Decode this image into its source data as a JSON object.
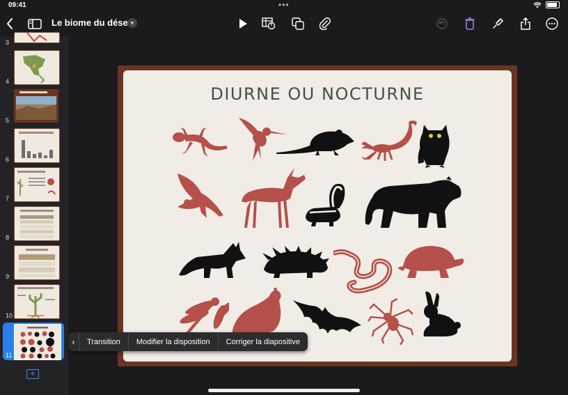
{
  "status_bar": {
    "time": "09:41"
  },
  "toolbar": {
    "document_title": "Le biome du désert",
    "icons": [
      "back-chevron-icon",
      "sidebar-toggle-icon",
      "play-icon",
      "table-chart-icon",
      "shapes-icon",
      "attachment-icon",
      "undo-icon",
      "trash-icon",
      "format-brush-icon",
      "share-icon",
      "more-icon"
    ],
    "accent_color": "#b37cf2"
  },
  "navigator": {
    "slides": [
      {
        "number": "3",
        "theme": "map"
      },
      {
        "number": "4",
        "theme": "map"
      },
      {
        "number": "5",
        "theme": "photo"
      },
      {
        "number": "6",
        "theme": "bar-chart"
      },
      {
        "number": "7",
        "theme": "text-image"
      },
      {
        "number": "8",
        "theme": "table"
      },
      {
        "number": "9",
        "theme": "table"
      },
      {
        "number": "10",
        "theme": "diagram"
      },
      {
        "number": "11",
        "theme": "animals",
        "selected": true
      }
    ],
    "selection_color": "#2a7fe8"
  },
  "slide": {
    "title": "DIURNE OU NOCTURNE",
    "frame_color": "#6b3420",
    "background_color": "#f1ede6",
    "diurnal_color": "#b5504a",
    "nocturnal_color": "#111111",
    "animals": [
      {
        "name": "gecko",
        "nocturnal": false
      },
      {
        "name": "hummingbird",
        "nocturnal": false
      },
      {
        "name": "rat",
        "nocturnal": true
      },
      {
        "name": "scorpion",
        "nocturnal": false
      },
      {
        "name": "owl",
        "nocturnal": true
      },
      {
        "name": "hawk",
        "nocturnal": false
      },
      {
        "name": "deer",
        "nocturnal": false
      },
      {
        "name": "skunk",
        "nocturnal": true
      },
      {
        "name": "cougar",
        "nocturnal": true
      },
      {
        "name": "fox",
        "nocturnal": true
      },
      {
        "name": "porcupine",
        "nocturnal": true
      },
      {
        "name": "snake",
        "nocturnal": false
      },
      {
        "name": "tortoise",
        "nocturnal": false
      },
      {
        "name": "dragonfly",
        "nocturnal": false
      },
      {
        "name": "quail",
        "nocturnal": false
      },
      {
        "name": "bat",
        "nocturnal": true
      },
      {
        "name": "spider",
        "nocturnal": false
      },
      {
        "name": "rabbit",
        "nocturnal": true
      }
    ]
  },
  "context_menu": {
    "items": [
      "Transition",
      "Modifier la disposition",
      "Corriger la diapositive"
    ]
  }
}
